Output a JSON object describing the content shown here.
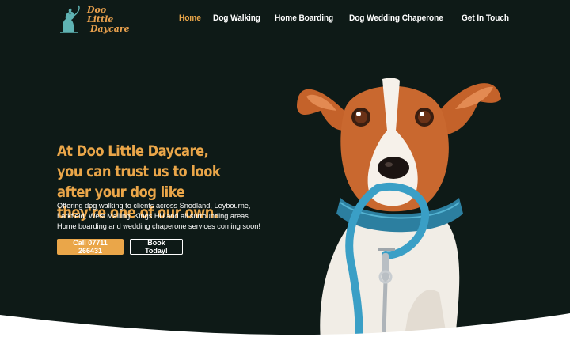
{
  "header": {
    "logo": {
      "line1": "Doo Little",
      "line2": "Daycare",
      "icon": "dog-leash-icon"
    },
    "nav": [
      {
        "label": "Home",
        "active": true
      },
      {
        "label": "Dog Walking",
        "active": false
      },
      {
        "label": "Home Boarding",
        "active": false
      },
      {
        "label": "Dog Wedding Chaperone",
        "active": false
      },
      {
        "label": "Get In Touch",
        "active": false
      }
    ]
  },
  "hero": {
    "headline": "At Doo Little Daycare, you can trust us to look after your dog like they're one of our own.",
    "subtext": "Offering dog walking to clients across Snodland, Leybourne, Larkfield, West Malling, Kings Hill and all surrounding areas. Home boarding and wedding chaperone services coming soon!",
    "buttons": {
      "call": "Call 07711 266431",
      "book": "Book Today!"
    },
    "image": "terrier-with-blue-leash"
  },
  "colors": {
    "background": "#0e1a17",
    "accent": "#eaa649",
    "logo_teal": "#5fb3b3",
    "text": "#ffffff"
  }
}
